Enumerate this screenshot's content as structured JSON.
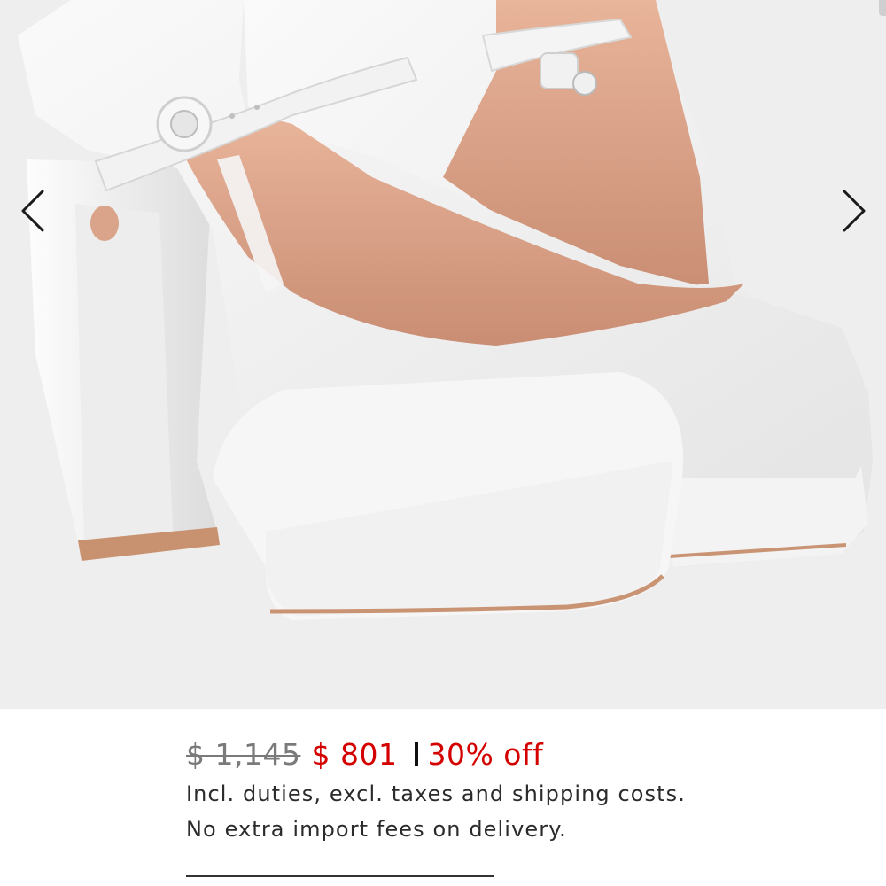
{
  "gallery": {
    "image_description": "white leather Mary Jane platform pumps",
    "prev_icon": "chevron-left-icon",
    "next_icon": "chevron-right-icon"
  },
  "pricing": {
    "original_price": "$ 1,145",
    "sale_price": "$ 801",
    "discount": "30% off",
    "sale_color": "#d40000"
  },
  "info": {
    "line1": "Incl. duties, excl. taxes and shipping costs.",
    "line2": "No extra import fees on delivery."
  }
}
